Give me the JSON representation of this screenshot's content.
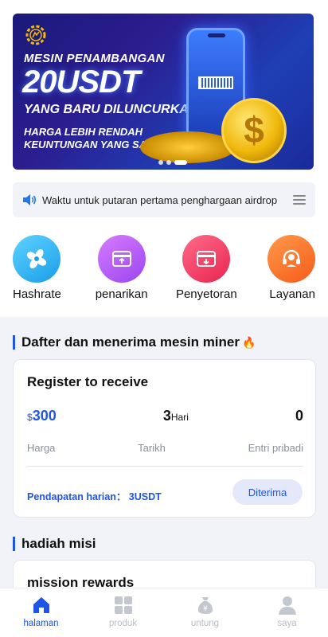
{
  "banner": {
    "line1": "MESIN PENAMBANGAN",
    "line2": "20USDT",
    "line3": "YANG BARU DILUNCURKAN",
    "line4": "HARGA LEBIH RENDAH",
    "line5": "KEUNTUNGAN YANG SAMA",
    "coin_symbol": "$",
    "slides": 3,
    "active_slide": 3
  },
  "notice": {
    "text": "Waktu untuk putaran pertama penghargaan airdrop"
  },
  "quick_actions": [
    {
      "label": "Hashrate",
      "icon": "fan-icon",
      "color": "#1a9ee8"
    },
    {
      "label": "penarikan",
      "icon": "withdraw-icon",
      "color": "#9a46f0"
    },
    {
      "label": "Penyetoran",
      "icon": "deposit-icon",
      "color": "#e8254f"
    },
    {
      "label": "Layanan",
      "icon": "headset-icon",
      "color": "#f55b1a"
    }
  ],
  "section1": {
    "title": "Dafter dan menerima mesin miner",
    "icon": "fire-icon"
  },
  "register_card": {
    "title": "Register to receive",
    "price_currency": "$",
    "price_value": "300",
    "period_value": "3",
    "period_unit": "Hari",
    "personal_entries": "0",
    "label_price": "Harga",
    "label_period": "Tarikh",
    "label_entries": "Entri pribadi",
    "daily_income": "Pendapatan harian： 3USDT",
    "button_label": "Diterima"
  },
  "section2": {
    "title": "hadiah misi"
  },
  "mission_card": {
    "title": "mission rewards"
  },
  "tabs": [
    {
      "label": "halaman",
      "icon": "home-icon",
      "active": true
    },
    {
      "label": "produk",
      "icon": "grid-icon",
      "active": false
    },
    {
      "label": "untung",
      "icon": "money-bag-icon",
      "active": false
    },
    {
      "label": "saya",
      "icon": "user-icon",
      "active": false
    }
  ],
  "colors": {
    "accent": "#1f54e8",
    "background": "#f1f3f8",
    "inactive_tab": "#b9bdc6"
  }
}
